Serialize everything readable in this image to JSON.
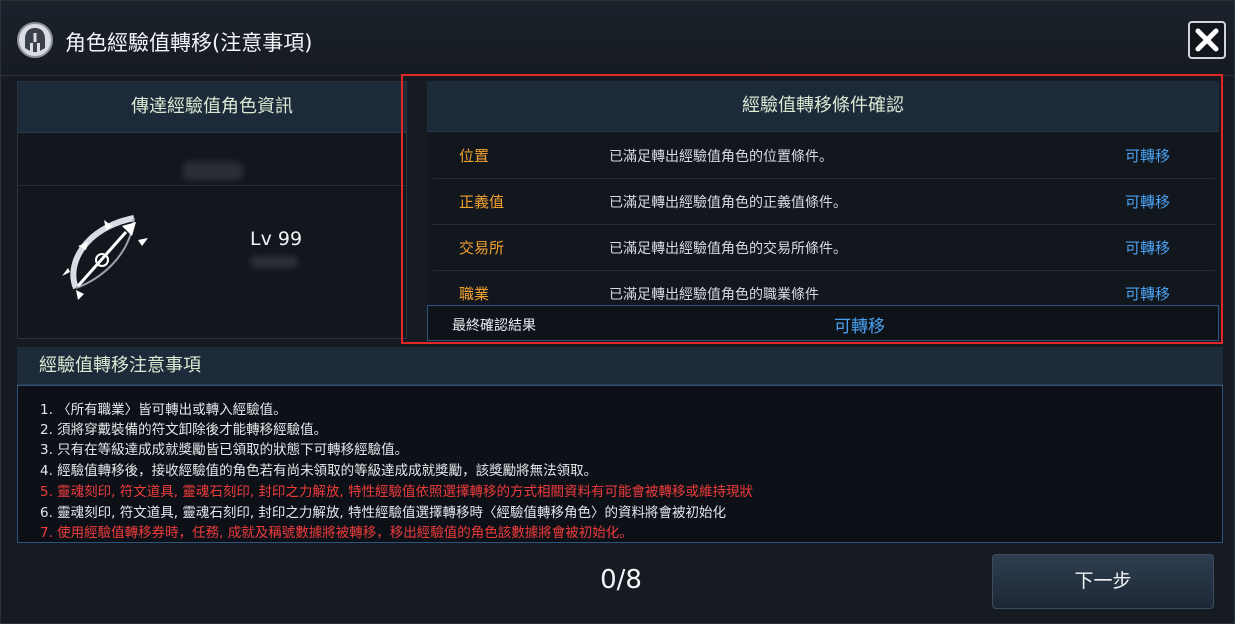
{
  "window": {
    "title": "角色經驗值轉移(注意事項)",
    "title_icon": "helmet-icon",
    "close_icon": "close-icon"
  },
  "source_character": {
    "header": "傳達經驗值角色資訊",
    "level": "Lv 99",
    "class_icon": "bow-icon"
  },
  "conditions": {
    "header": "經驗值轉移條件確認",
    "rows": [
      {
        "name": "位置",
        "description": "已滿足轉出經驗值角色的位置條件。",
        "status": "可轉移"
      },
      {
        "name": "正義值",
        "description": "已滿足轉出經驗值角色的正義值條件。",
        "status": "可轉移"
      },
      {
        "name": "交易所",
        "description": "已滿足轉出經驗值角色的交易所條件。",
        "status": "可轉移"
      },
      {
        "name": "職業",
        "description": "已滿足轉出經驗值角色的職業條件",
        "status": "可轉移"
      }
    ],
    "final_label": "最終確認結果",
    "final_value": "可轉移"
  },
  "notes": {
    "header": "經驗值轉移注意事項",
    "items": [
      "1. 〈所有職業〉皆可轉出或轉入經驗值。",
      "2. 須將穿戴裝備的符文卸除後才能轉移經驗值。",
      "3. 只有在等級達成成就獎勵皆已領取的狀態下可轉移經驗值。",
      "4. 經驗值轉移後，接收經驗值的角色若有尚未領取的等級達成成就獎勵，該獎勵將無法領取。",
      "5. 靈魂刻印, 符文道具, 靈魂石刻印, 封印之力解放, 特性經驗值依照選擇轉移的方式相關資料有可能會被轉移或維持現狀",
      "6. 靈魂刻印, 符文道具, 靈魂石刻印, 封印之力解放, 特性經驗值選擇轉移時〈經驗值轉移角色〉的資料將會被初始化",
      "7. 使用經驗值轉移券時，任務, 成就及稱號數據將被轉移，移出經驗值的角色該數據將會被初始化。"
    ],
    "red_items": [
      4,
      6
    ]
  },
  "footer": {
    "page_count": "0/8",
    "next_label": "下一步"
  },
  "colors": {
    "accent_blue": "#4aa0f0",
    "condition_orange": "#f0a030",
    "warning_red": "#ee3b3b",
    "highlight_red": "#e02828"
  }
}
